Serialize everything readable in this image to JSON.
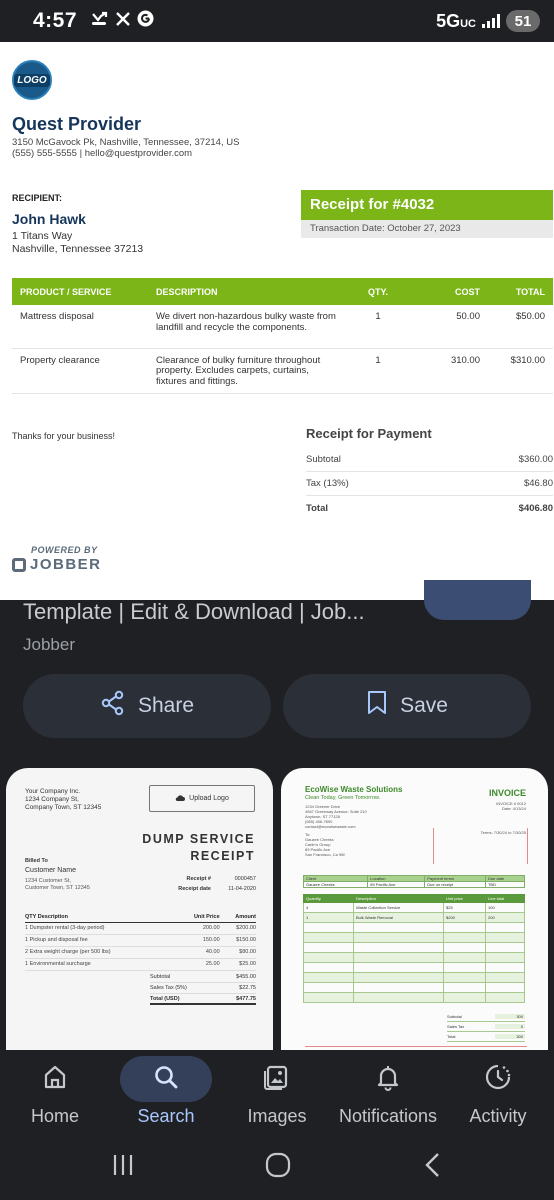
{
  "status_bar": {
    "time": "4:57",
    "icons": [
      "missed-call-icon",
      "x-icon",
      "google-g-icon"
    ],
    "network": "5G",
    "network_suffix": "UC",
    "battery": "51"
  },
  "receipt": {
    "logo_text": "LOGO",
    "company_name": "Quest Provider",
    "company_address": "3150 McGavock Pk, Nashville, Tennessee, 37214, US",
    "company_contact": "(555) 555-5555 | hello@questprovider.com",
    "recipient_label": "RECIPIENT:",
    "recipient_name": "John Hawk",
    "recipient_address1": "1 Titans Way",
    "recipient_address2": "Nashville, Tennessee 37213",
    "receipt_title": "Receipt for #4032",
    "transaction_date": "Transaction Date: October 27, 2023",
    "columns": [
      "PRODUCT / SERVICE",
      "DESCRIPTION",
      "QTY.",
      "COST",
      "TOTAL"
    ],
    "items": [
      {
        "service": "Mattress disposal",
        "description": "We divert non-hazardous bulky waste from landfill and recycle the components.",
        "qty": "1",
        "cost": "50.00",
        "total": "$50.00"
      },
      {
        "service": "Property clearance",
        "description": "Clearance of bulky furniture throughout property. Excludes carpets, curtains, fixtures and fittings.",
        "qty": "1",
        "cost": "310.00",
        "total": "$310.00"
      }
    ],
    "thanks": "Thanks for your business!",
    "payment_title": "Receipt for Payment",
    "subtotal_label": "Subtotal",
    "subtotal_value": "$360.00",
    "tax_label": "Tax (13%)",
    "tax_value": "$46.80",
    "total_label": "Total",
    "total_value": "$406.80",
    "powered_by": "POWERED BY",
    "jobber_brand": "JOBBER"
  },
  "result": {
    "title": "Template | Edit & Download | Job...",
    "source": "Jobber",
    "share_label": "Share",
    "save_label": "Save"
  },
  "related_left": {
    "company": "Your Company Inc.",
    "company_addr1": "1234 Company St,",
    "company_addr2": "Company Town, ST 12345",
    "upload_label": "Upload Logo",
    "title_line1": "DUMP SERVICE",
    "title_line2": "RECEIPT",
    "billed_to": "Billed To",
    "customer_name": "Customer Name",
    "customer_addr1": "1234 Customer St,",
    "customer_addr2": "Customer Town, ST 12345",
    "receipt_no_label": "Receipt #",
    "receipt_no": "0000457",
    "receipt_date_label": "Receipt date",
    "receipt_date": "11-04-2020",
    "columns": [
      "QTY  Description",
      "Unit Price",
      "Amount"
    ],
    "rows": [
      {
        "desc": "1   Dumpster rental (3-day period)",
        "unit": "200.00",
        "amount": "$200.00"
      },
      {
        "desc": "1   Pickup and disposal fee",
        "unit": "150.00",
        "amount": "$150.00"
      },
      {
        "desc": "2   Extra weight charge (per 500 lbs)",
        "unit": "40.00",
        "amount": "$80.00"
      },
      {
        "desc": "1   Environmental surcharge",
        "unit": "25.00",
        "amount": "$25.00"
      }
    ],
    "subtotal_label": "Subtotal",
    "subtotal": "$455.00",
    "tax_label": "Sales Tax (5%)",
    "tax": "$22.75",
    "total_label": "Total (USD)",
    "total": "$477.75"
  },
  "related_right": {
    "company": "EcoWise Waste Solutions",
    "tagline": "Clean Today, Green Tomorrow.",
    "addr_lines": [
      "1234 Greener Drive",
      "4567 Greenway Avenue, Suite 210",
      "Anytown, ST 77128",
      "(555) 456-7890",
      "contact@ecowisewaste.com"
    ],
    "invoice_label": "INVOICE",
    "invoice_meta": [
      "INVOICE # 0012",
      "Date: 4/13/24"
    ],
    "to_lines": [
      "To:",
      "Gauzee Cheeks",
      "Carlin's Group",
      "89 Pacific Ave",
      "San Francisco, Ca 98f"
    ],
    "terms": "Terms: 7/30/24 to 7/30/25",
    "info_headers": [
      "Client",
      "Location",
      "Payment terms",
      "Due date"
    ],
    "info_values": [
      "Gauzee Cheeks",
      "89 Pacific Ave",
      "Due on receipt",
      "TBD"
    ],
    "item_headers": [
      "Quantity",
      "Description",
      "Unit price",
      "Line total"
    ],
    "item_rows": [
      [
        "4",
        "Waste Collection Service",
        "$25",
        "100"
      ],
      [
        "1",
        "Bulk Waste Removal",
        "$200",
        "200"
      ],
      [
        "",
        "",
        "",
        ""
      ],
      [
        "",
        "",
        "",
        ""
      ],
      [
        "",
        "",
        "",
        ""
      ],
      [
        "",
        "",
        "",
        ""
      ],
      [
        "",
        "",
        "",
        ""
      ],
      [
        "",
        "",
        "",
        ""
      ],
      [
        "",
        "",
        "",
        ""
      ],
      [
        "",
        "",
        "",
        ""
      ]
    ],
    "subtotal_label": "Subtotal",
    "subtotal": "300",
    "tax_label": "Sales Tax",
    "tax": "0",
    "total_label": "Total",
    "total": "300"
  },
  "bottom_nav": {
    "items": [
      {
        "label": "Home",
        "icon": "home-icon"
      },
      {
        "label": "Search",
        "icon": "search-icon"
      },
      {
        "label": "Images",
        "icon": "images-icon"
      },
      {
        "label": "Notifications",
        "icon": "bell-icon"
      },
      {
        "label": "Activity",
        "icon": "activity-icon"
      }
    ],
    "active": "Search"
  },
  "colors": {
    "accent_green": "#7cb518",
    "brand_navy": "#15365a",
    "active_nav": "#a8c7fa",
    "background": "#1f2023"
  }
}
